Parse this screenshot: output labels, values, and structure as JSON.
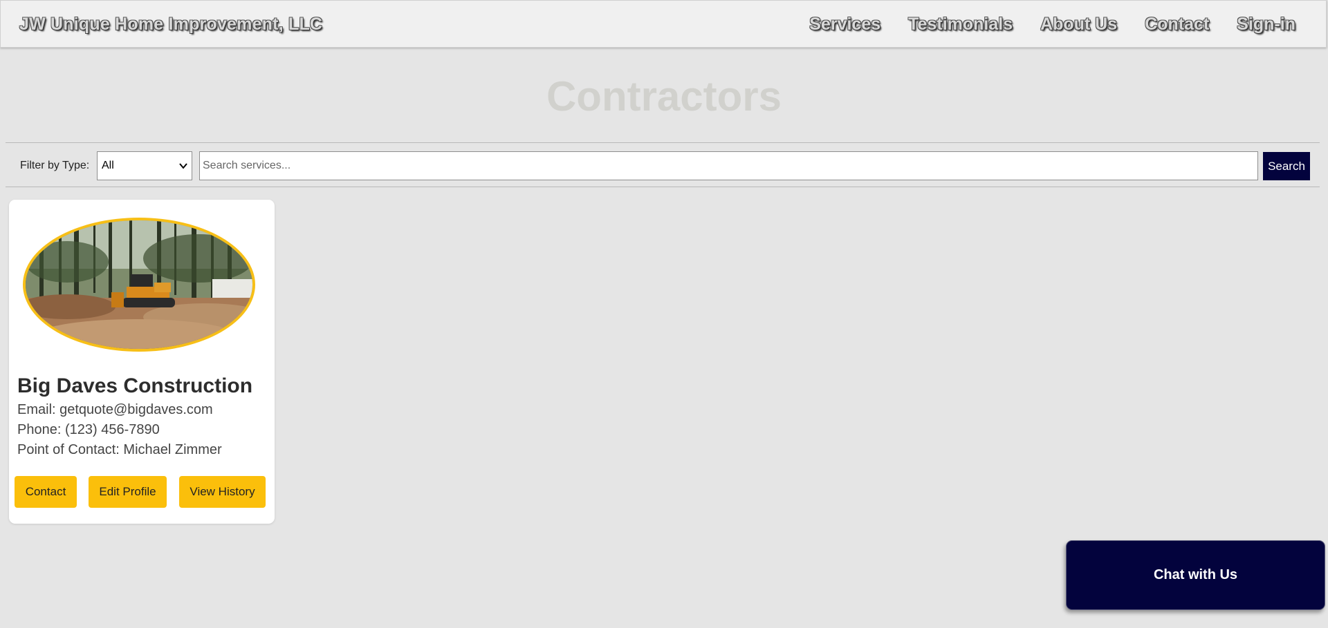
{
  "navbar": {
    "brand": "JW Unique Home Improvement, LLC",
    "links": [
      "Services",
      "Testimonials",
      "About Us",
      "Contact",
      "Sign-in"
    ]
  },
  "page": {
    "title": "Contractors"
  },
  "filter": {
    "label": "Filter by Type:",
    "selected": "All",
    "search_placeholder": "Search services...",
    "search_button": "Search"
  },
  "contractors": [
    {
      "name": "Big Daves Construction",
      "email_line": "Email: getquote@bigdaves.com",
      "phone_line": "Phone: (123) 456-7890",
      "contact_line": "Point of Contact: Michael Zimmer",
      "buttons": [
        "Contact",
        "Edit Profile",
        "View History"
      ]
    }
  ],
  "chat": {
    "label": "Chat with Us"
  },
  "colors": {
    "accent": "#fbbf0b",
    "primary": "#03033d",
    "background": "#e5e5e5"
  }
}
